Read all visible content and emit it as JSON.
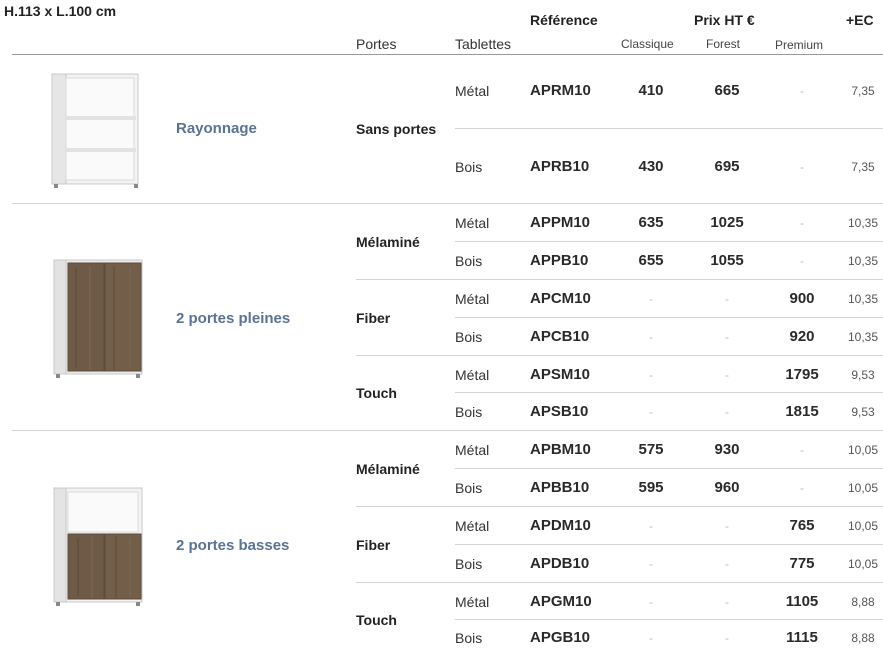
{
  "header": {
    "dimensions": "H.113 x L.100  cm",
    "reference": "Référence",
    "price": "Prix HT €",
    "ec": "+EC",
    "doors": "Portes",
    "shelves": "Tablettes",
    "classique": "Classique",
    "forest": "Forest",
    "premium": "Premium"
  },
  "groups": [
    {
      "name": "Rayonnage",
      "image_icon": "open-shelf-cabinet-image",
      "doors": [
        {
          "label": "Sans portes",
          "rows": [
            {
              "shelf": "Métal",
              "ref": "APRM10",
              "classique": "410",
              "forest": "665",
              "premium": "-",
              "ec": "7,35"
            },
            {
              "shelf": "Bois",
              "ref": "APRB10",
              "classique": "430",
              "forest": "695",
              "premium": "-",
              "ec": "7,35"
            }
          ]
        }
      ]
    },
    {
      "name": "2 portes pleines",
      "image_icon": "two-full-doors-cabinet-image",
      "doors": [
        {
          "label": "Mélaminé",
          "rows": [
            {
              "shelf": "Métal",
              "ref": "APPM10",
              "classique": "635",
              "forest": "1025",
              "premium": "-",
              "ec": "10,35"
            },
            {
              "shelf": "Bois",
              "ref": "APPB10",
              "classique": "655",
              "forest": "1055",
              "premium": "-",
              "ec": "10,35"
            }
          ]
        },
        {
          "label": "Fiber",
          "rows": [
            {
              "shelf": "Métal",
              "ref": "APCM10",
              "classique": "-",
              "forest": "-",
              "premium": "900",
              "ec": "10,35"
            },
            {
              "shelf": "Bois",
              "ref": "APCB10",
              "classique": "-",
              "forest": "-",
              "premium": "920",
              "ec": "10,35"
            }
          ]
        },
        {
          "label": "Touch",
          "rows": [
            {
              "shelf": "Métal",
              "ref": "APSM10",
              "classique": "-",
              "forest": "-",
              "premium": "1795",
              "ec": "9,53"
            },
            {
              "shelf": "Bois",
              "ref": "APSB10",
              "classique": "-",
              "forest": "-",
              "premium": "1815",
              "ec": "9,53"
            }
          ]
        }
      ]
    },
    {
      "name": "2 portes basses",
      "image_icon": "two-low-doors-cabinet-image",
      "doors": [
        {
          "label": "Mélaminé",
          "rows": [
            {
              "shelf": "Métal",
              "ref": "APBM10",
              "classique": "575",
              "forest": "930",
              "premium": "-",
              "ec": "10,05"
            },
            {
              "shelf": "Bois",
              "ref": "APBB10",
              "classique": "595",
              "forest": "960",
              "premium": "-",
              "ec": "10,05"
            }
          ]
        },
        {
          "label": "Fiber",
          "rows": [
            {
              "shelf": "Métal",
              "ref": "APDM10",
              "classique": "-",
              "forest": "-",
              "premium": "765",
              "ec": "10,05"
            },
            {
              "shelf": "Bois",
              "ref": "APDB10",
              "classique": "-",
              "forest": "-",
              "premium": "775",
              "ec": "10,05"
            }
          ]
        },
        {
          "label": "Touch",
          "rows": [
            {
              "shelf": "Métal",
              "ref": "APGM10",
              "classique": "-",
              "forest": "-",
              "premium": "1105",
              "ec": "8,88"
            },
            {
              "shelf": "Bois",
              "ref": "APGB10",
              "classique": "-",
              "forest": "-",
              "premium": "1115",
              "ec": "8,88"
            }
          ]
        }
      ]
    }
  ],
  "colors": {
    "product_name": "#5a7395",
    "wood_door": "#6e5a47",
    "divider": "#d4d4d4"
  }
}
